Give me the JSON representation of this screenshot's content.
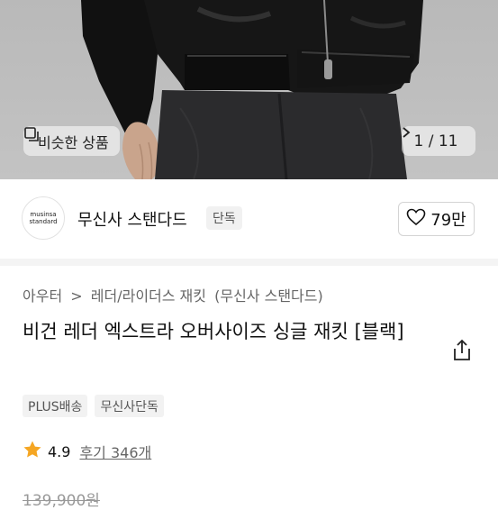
{
  "gallery": {
    "similar_label": "비슷한 상품",
    "similar_icon": "similar-products-icon",
    "pager": "1 / 11",
    "pager_icon": "chevron-right-icon"
  },
  "brand": {
    "logo_line1": "musinsa",
    "logo_line2": "standard",
    "name": "무신사 스탠다드",
    "badge": "단독",
    "like_icon": "heart-icon",
    "like_count": "79만"
  },
  "breadcrumb": {
    "items": [
      "아우터",
      "레더/라이더스 재킷",
      "(무신사 스탠다드)"
    ],
    "separator": ">"
  },
  "product": {
    "title": "비건 레더 엑스트라 오버사이즈 싱글 재킷 [블랙]",
    "share_icon": "share-icon",
    "tags": [
      "PLUS배송",
      "무신사단독"
    ],
    "rating_icon": "star-icon",
    "rating": "4.9",
    "reviews": "후기 346개",
    "price_original": "139,900원"
  },
  "colors": {
    "star": "#f5a623",
    "tag_bg": "#f2f2f2",
    "divider": "#f4f4f4"
  }
}
